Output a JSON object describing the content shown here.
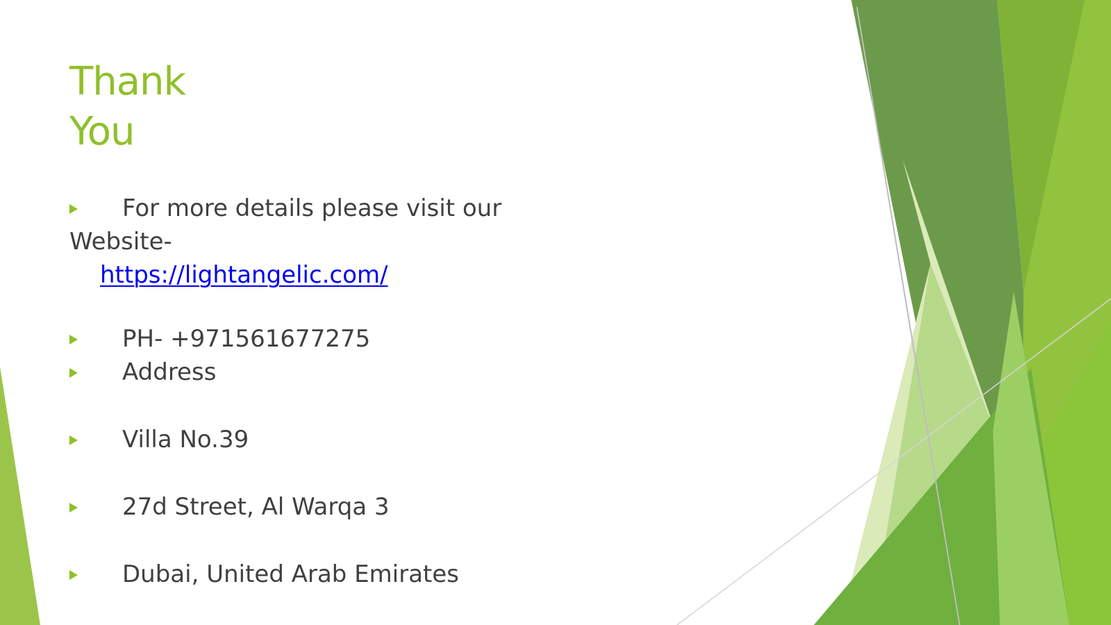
{
  "title": {
    "line1": "Thank",
    "line2": "You"
  },
  "website": {
    "intro": "For more details please visit our",
    "label": "Website-",
    "url": "https://lightangelic.com/"
  },
  "contact": {
    "phone": "PH- +971561677275",
    "address_label": "Address",
    "address_line1": "Villa No.39",
    "address_line2": "27d Street, Al Warqa 3",
    "address_line3": "Dubai, United Arab Emirates"
  },
  "colors": {
    "accent": "#8fc02b",
    "text": "#404040",
    "link": "#0000ee"
  },
  "icons": {
    "bullet": "triangle-bullet-icon"
  }
}
